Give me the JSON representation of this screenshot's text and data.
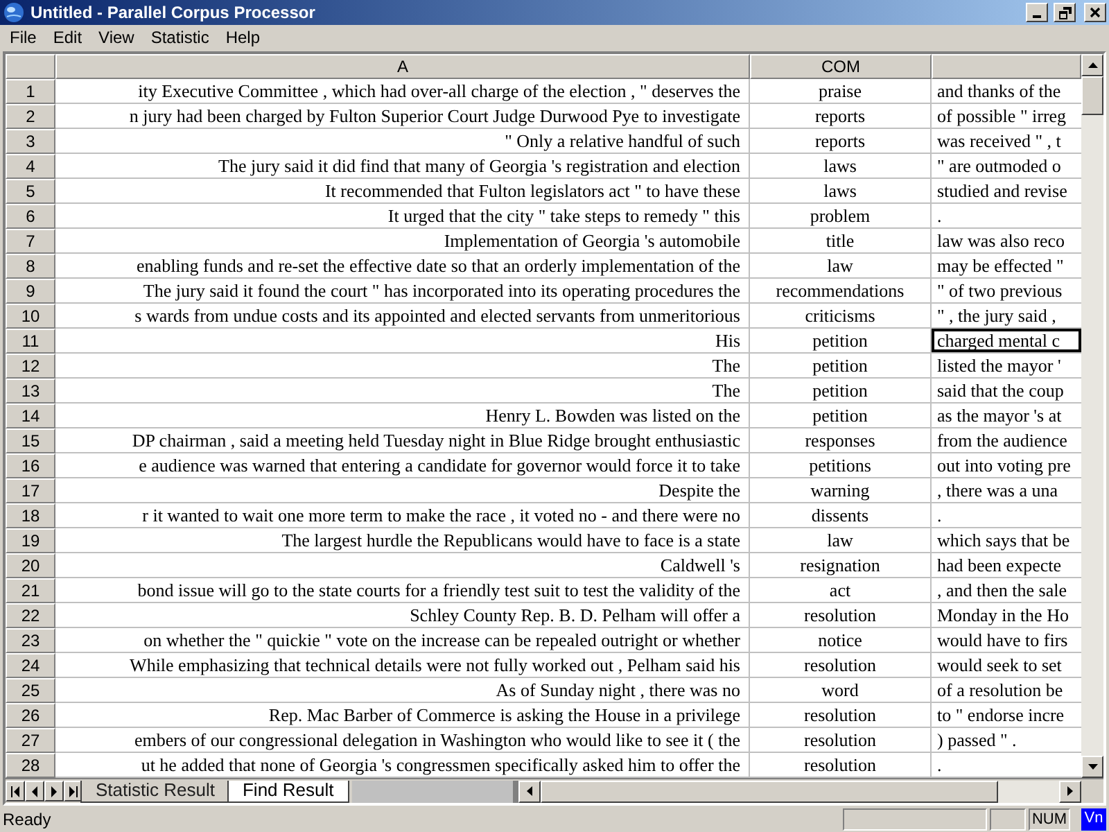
{
  "window": {
    "title": "Untitled - Parallel Corpus Processor"
  },
  "menu": [
    "File",
    "Edit",
    "View",
    "Statistic",
    "Help"
  ],
  "table": {
    "columns": [
      "A",
      "COM"
    ],
    "rows": [
      {
        "number": "1",
        "a": "ity Executive Committee , which had over-all charge of the election , \" deserves the",
        "com": "praise",
        "column_3": "and thanks of the",
        "selected": false
      },
      {
        "number": "2",
        "a": "n jury had been charged by Fulton Superior Court Judge Durwood Pye to investigate",
        "com": "reports",
        "column_3": "of possible \" irreg",
        "selected": false
      },
      {
        "number": "3",
        "a": "\" Only a relative handful of such",
        "com": "reports",
        "column_3": "was received \" , t",
        "selected": false
      },
      {
        "number": "4",
        "a": "The jury said it did find that many of Georgia 's registration and election",
        "com": "laws",
        "column_3": "\" are outmoded o",
        "selected": false
      },
      {
        "number": "5",
        "a": "It recommended that Fulton legislators act \" to have these",
        "com": "laws",
        "column_3": "studied and revise",
        "selected": false
      },
      {
        "number": "6",
        "a": "It urged that the city \" take steps to remedy \" this",
        "com": "problem",
        "column_3": ".",
        "selected": false
      },
      {
        "number": "7",
        "a": "Implementation of Georgia 's automobile",
        "com": "title",
        "column_3": "law was also reco",
        "selected": false
      },
      {
        "number": "8",
        "a": "enabling funds and re-set the effective date so that an orderly implementation of the",
        "com": "law",
        "column_3": "may be effected \"",
        "selected": false
      },
      {
        "number": "9",
        "a": "The jury said it found the court \" has incorporated into its operating procedures the",
        "com": "recommendations",
        "column_3": "\" of two previous",
        "selected": false
      },
      {
        "number": "10",
        "a": "s wards from undue costs and its appointed and elected servants from unmeritorious",
        "com": "criticisms",
        "column_3": "\" , the jury said ,",
        "selected": false
      },
      {
        "number": "11",
        "a": "His",
        "com": "petition",
        "column_3": "charged mental c",
        "selected": true
      },
      {
        "number": "12",
        "a": "The",
        "com": "petition",
        "column_3": "listed the mayor '",
        "selected": false
      },
      {
        "number": "13",
        "a": "The",
        "com": "petition",
        "column_3": "said that the coup",
        "selected": false
      },
      {
        "number": "14",
        "a": "Henry L. Bowden was listed on the",
        "com": "petition",
        "column_3": "as the mayor 's at",
        "selected": false
      },
      {
        "number": "15",
        "a": "DP chairman , said a meeting held Tuesday night in Blue Ridge brought enthusiastic",
        "com": "responses",
        "column_3": "from the audience",
        "selected": false
      },
      {
        "number": "16",
        "a": "e audience was warned that entering a candidate for governor would force it to take",
        "com": "petitions",
        "column_3": "out into voting pre",
        "selected": false
      },
      {
        "number": "17",
        "a": "Despite the",
        "com": "warning",
        "column_3": ", there was a una",
        "selected": false
      },
      {
        "number": "18",
        "a": "r it wanted to wait one more term to make the race , it voted no - and there were no",
        "com": "dissents",
        "column_3": ".",
        "selected": false
      },
      {
        "number": "19",
        "a": "The largest hurdle the Republicans would have to face is a state",
        "com": "law",
        "column_3": "which says that be",
        "selected": false
      },
      {
        "number": "20",
        "a": "Caldwell 's",
        "com": "resignation",
        "column_3": "had been expecte",
        "selected": false
      },
      {
        "number": "21",
        "a": "bond issue will go to the state courts for a friendly test suit to test the validity of the",
        "com": "act",
        "column_3": ", and then the sale",
        "selected": false
      },
      {
        "number": "22",
        "a": "Schley County Rep. B. D. Pelham will offer a",
        "com": "resolution",
        "column_3": "Monday in the Ho",
        "selected": false
      },
      {
        "number": "23",
        "a": "on whether the \" quickie \" vote on the increase can be repealed outright or whether",
        "com": "notice",
        "column_3": "would have to firs",
        "selected": false
      },
      {
        "number": "24",
        "a": "While emphasizing that technical details were not fully worked out , Pelham said his",
        "com": "resolution",
        "column_3": "would seek to set",
        "selected": false
      },
      {
        "number": "25",
        "a": "As of Sunday night , there was no",
        "com": "word",
        "column_3": "of a resolution be",
        "selected": false
      },
      {
        "number": "26",
        "a": "Rep. Mac Barber of Commerce is asking the House in a privilege",
        "com": "resolution",
        "column_3": "to \" endorse incre",
        "selected": false
      },
      {
        "number": "27",
        "a": "embers of our congressional delegation in Washington who would like to see it ( the",
        "com": "resolution",
        "column_3": ") passed \" .",
        "selected": false
      },
      {
        "number": "28",
        "a": "ut he added that none of Georgia 's congressmen specifically asked him to offer the",
        "com": "resolution",
        "column_3": ".",
        "selected": false
      }
    ]
  },
  "sheet_tabs": [
    {
      "label": "Statistic Result",
      "selected": false
    },
    {
      "label": "Find Result",
      "selected": true
    }
  ],
  "status_bar": {
    "text": "Ready",
    "num": "NUM",
    "language": "Vn"
  }
}
